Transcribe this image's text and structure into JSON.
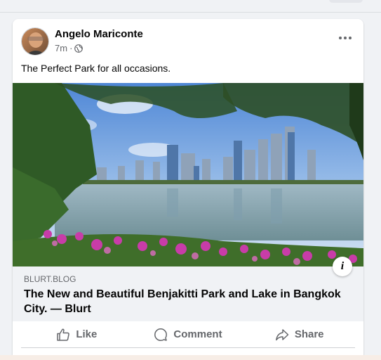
{
  "post": {
    "author": "Angelo Mariconte",
    "time": "7m",
    "separator": "·",
    "text": "The Perfect Park for all occasions."
  },
  "link_preview": {
    "domain": "BLURT.BLOG",
    "title": "The New and Beautiful Benjakitti Park and Lake in Bangkok City. — Blurt",
    "info_label": "i"
  },
  "actions": {
    "like": "Like",
    "comment": "Comment",
    "share": "Share"
  },
  "icons": {
    "privacy": "globe-icon",
    "more": "more-icon",
    "info": "info-icon",
    "like": "thumbs-up-icon",
    "comment": "comment-icon",
    "share": "share-icon"
  },
  "colors": {
    "card_bg": "#ffffff",
    "page_bg": "#f0f2f5",
    "secondary_text": "#65676b",
    "primary_text": "#050505"
  }
}
